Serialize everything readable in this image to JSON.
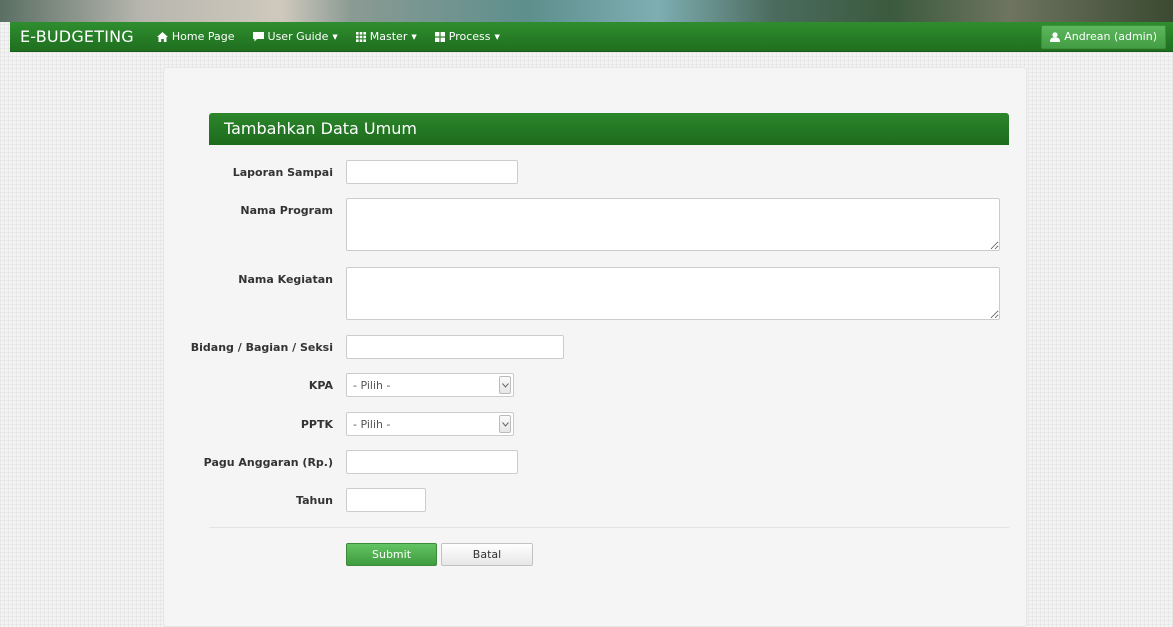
{
  "app": {
    "brand": "E-BUDGETING"
  },
  "nav": {
    "home": "Home Page",
    "user_guide": "User Guide",
    "master": "Master",
    "process": "Process",
    "user": "Andrean (admin)",
    "icons": {
      "home": "home-icon",
      "user_guide": "comment-icon",
      "master": "grid-icon",
      "process": "tiles-icon",
      "user": "user-icon"
    }
  },
  "form": {
    "title": "Tambahkan Data Umum",
    "fields": {
      "laporan_sampai": {
        "label": "Laporan Sampai",
        "value": ""
      },
      "nama_program": {
        "label": "Nama Program",
        "value": ""
      },
      "nama_kegiatan": {
        "label": "Nama Kegiatan",
        "value": ""
      },
      "bidang": {
        "label": "Bidang / Bagian / Seksi",
        "value": ""
      },
      "kpa": {
        "label": "KPA",
        "selected": "- Pilih -"
      },
      "pptk": {
        "label": "PPTK",
        "selected": "- Pilih -"
      },
      "pagu": {
        "label": "Pagu Anggaran (Rp.)",
        "value": ""
      },
      "tahun": {
        "label": "Tahun",
        "value": ""
      }
    },
    "buttons": {
      "submit": "Submit",
      "cancel": "Batal"
    }
  },
  "colors": {
    "navbar": "#267f26",
    "header": "#23772a",
    "submit": "#4cae4c"
  }
}
